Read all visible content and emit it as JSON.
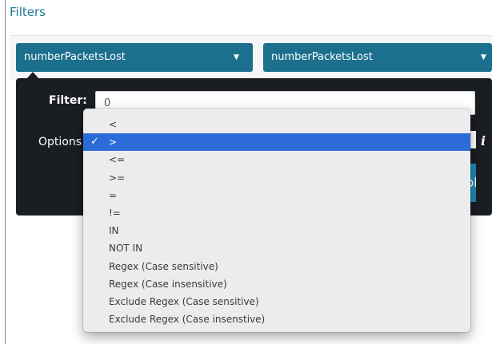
{
  "panel": {
    "title": "Filters"
  },
  "field_selects": [
    {
      "value": "numberPacketsLost"
    },
    {
      "value": "numberPacketsLost"
    }
  ],
  "filter_form": {
    "filter_label": "Filter:",
    "filter_value": "0",
    "options_label": "Options",
    "apply_label": "Apply"
  },
  "operator_dropdown": {
    "selected_index": 1,
    "options": [
      "<",
      ">",
      "<=",
      ">=",
      "=",
      "!=",
      "IN",
      "NOT IN",
      "Regex (Case sensitive)",
      "Regex (Case insensitive)",
      "Exclude Regex (Case sensitive)",
      "Exclude Regex (Case insenstive)"
    ]
  },
  "icons": {
    "caret": "caret-down-icon",
    "check": "checkmark-icon",
    "info": "info-icon"
  },
  "colors": {
    "title": "#1f7b98",
    "select_bg": "#1c6f8d",
    "popover_bg": "#1a1d21",
    "highlight": "#2d6cd8",
    "apply_bg": "#1f87b4"
  }
}
